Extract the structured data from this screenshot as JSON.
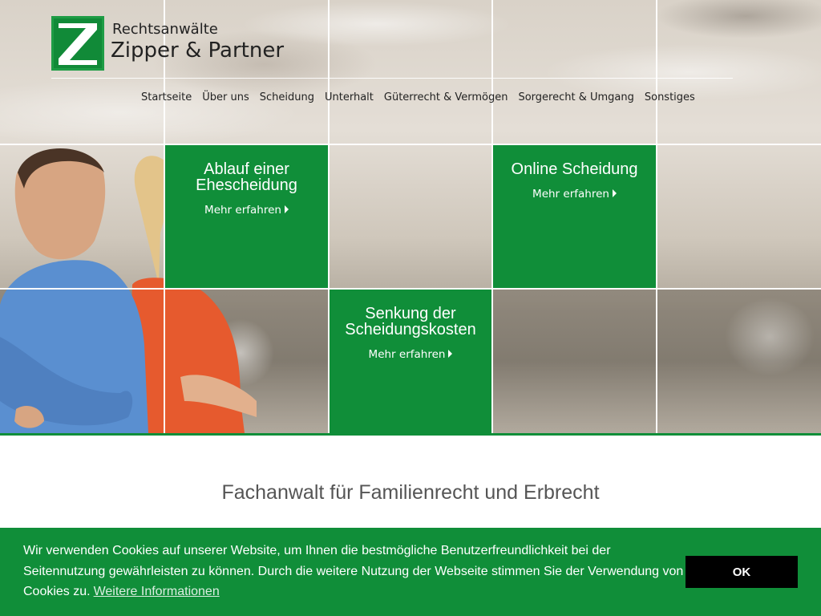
{
  "brand": {
    "logo_letter": "Z",
    "title": "Rechtsanwälte",
    "name": "Zipper & Partner"
  },
  "nav": {
    "items": [
      "Startseite",
      "Über uns",
      "Scheidung",
      "Unterhalt",
      "Güterrecht & Vermögen",
      "Sorgerecht & Umgang",
      "Sonstiges"
    ]
  },
  "tiles": [
    {
      "title_line1": "Ablauf einer",
      "title_line2": "Ehescheidung",
      "link": "Mehr erfahren"
    },
    {
      "title_line1": "Online Scheidung",
      "title_line2": "",
      "link": "Mehr erfahren"
    },
    {
      "title_line1": "Senkung der",
      "title_line2": "Scheidungskosten",
      "link": "Mehr erfahren"
    }
  ],
  "main": {
    "headline": "Fachanwalt für Familienrecht und Erbrecht"
  },
  "cookie": {
    "text": "Wir verwenden Cookies auf unserer Website, um Ihnen die bestmögliche Benutzerfreundlichkeit bei der Seitennutzung gewährleisten zu können. Durch die weitere Nutzung der Webseite stimmen Sie der Verwendung von Cookies zu.",
    "more_link": "Weitere Informationen",
    "ok_label": "OK"
  },
  "colors": {
    "brand_green": "#108e39",
    "button_black": "#000000"
  }
}
